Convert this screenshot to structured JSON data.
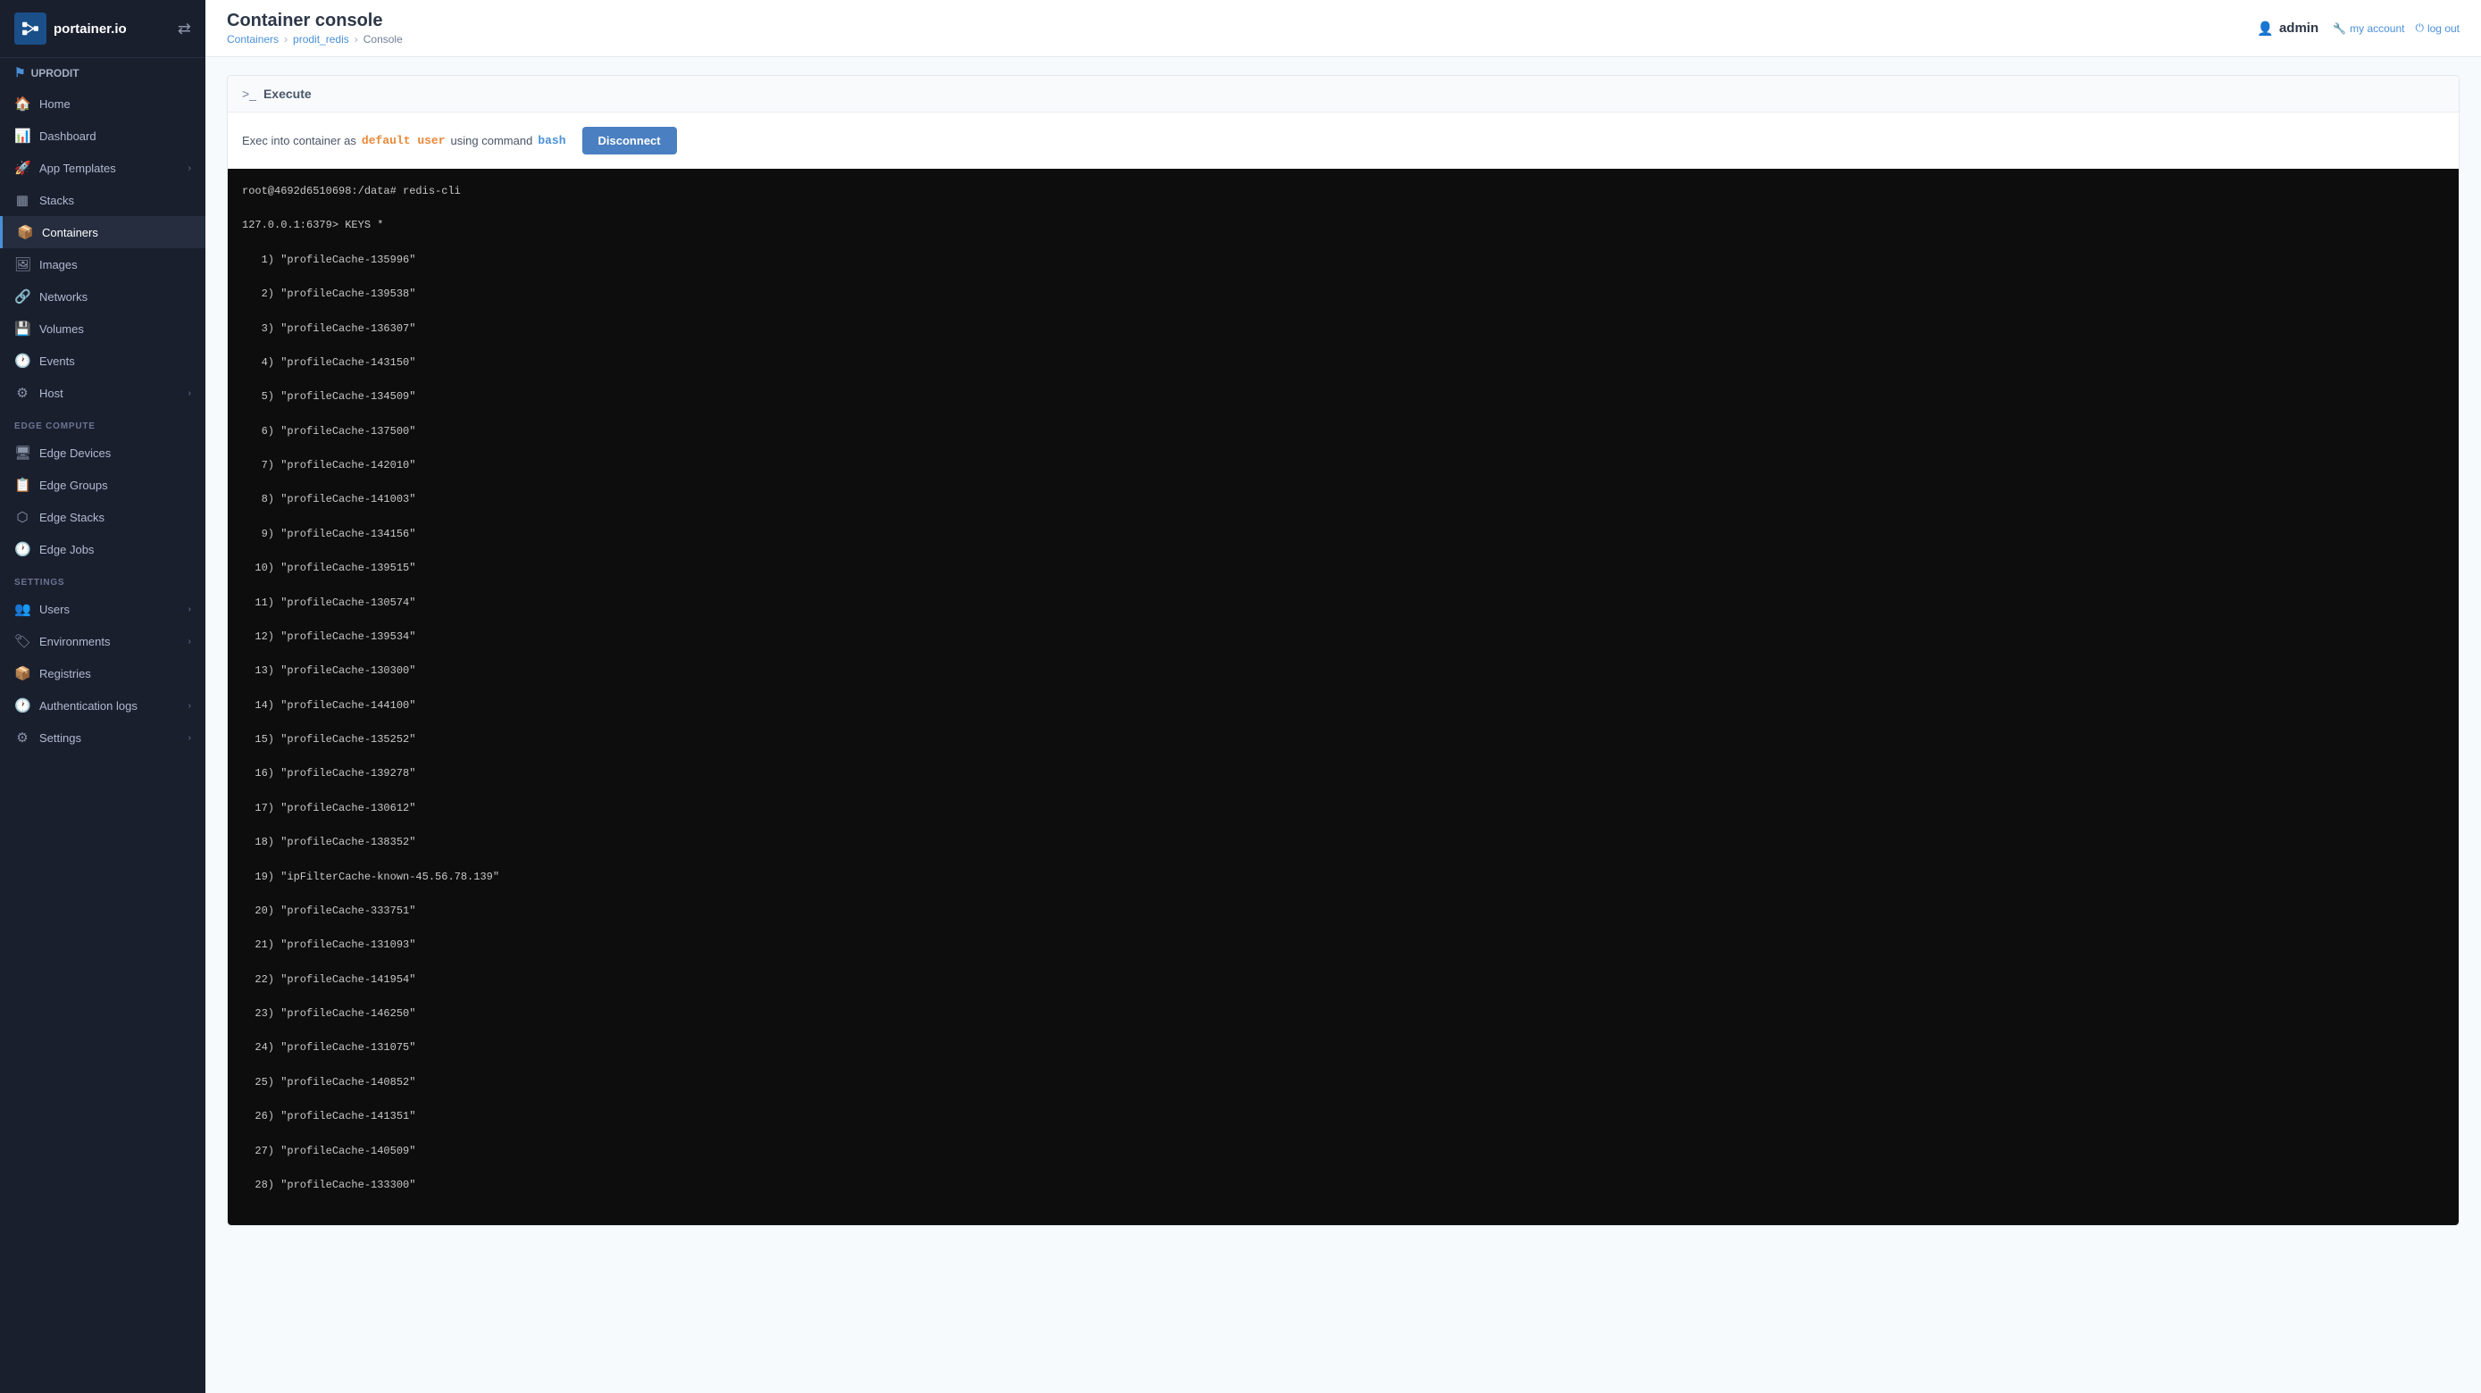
{
  "sidebar": {
    "logo_text": "portainer.io",
    "env_name": "UPRODIT",
    "items": [
      {
        "id": "home",
        "label": "Home",
        "icon": "🏠",
        "has_arrow": false,
        "active": false
      },
      {
        "id": "dashboard",
        "label": "Dashboard",
        "icon": "📊",
        "has_arrow": false,
        "active": false
      },
      {
        "id": "app-templates",
        "label": "App Templates",
        "icon": "🚀",
        "has_arrow": true,
        "active": false
      },
      {
        "id": "stacks",
        "label": "Stacks",
        "icon": "▦",
        "has_arrow": false,
        "active": false
      },
      {
        "id": "containers",
        "label": "Containers",
        "icon": "📦",
        "has_arrow": false,
        "active": true
      },
      {
        "id": "images",
        "label": "Images",
        "icon": "🖼",
        "has_arrow": false,
        "active": false
      },
      {
        "id": "networks",
        "label": "Networks",
        "icon": "🔗",
        "has_arrow": false,
        "active": false
      },
      {
        "id": "volumes",
        "label": "Volumes",
        "icon": "💾",
        "has_arrow": false,
        "active": false
      },
      {
        "id": "events",
        "label": "Events",
        "icon": "🕐",
        "has_arrow": false,
        "active": false
      },
      {
        "id": "host",
        "label": "Host",
        "icon": "⚙",
        "has_arrow": true,
        "active": false
      }
    ],
    "edge_compute_section": "EDGE COMPUTE",
    "edge_items": [
      {
        "id": "edge-devices",
        "label": "Edge Devices",
        "icon": "🖥",
        "has_arrow": false,
        "active": false
      },
      {
        "id": "edge-groups",
        "label": "Edge Groups",
        "icon": "📋",
        "has_arrow": false,
        "active": false
      },
      {
        "id": "edge-stacks",
        "label": "Edge Stacks",
        "icon": "⬡",
        "has_arrow": false,
        "active": false
      },
      {
        "id": "edge-jobs",
        "label": "Edge Jobs",
        "icon": "🕐",
        "has_arrow": false,
        "active": false
      }
    ],
    "settings_section": "SETTINGS",
    "settings_items": [
      {
        "id": "users",
        "label": "Users",
        "icon": "👥",
        "has_arrow": true,
        "active": false
      },
      {
        "id": "environments",
        "label": "Environments",
        "icon": "🏷",
        "has_arrow": true,
        "active": false
      },
      {
        "id": "registries",
        "label": "Registries",
        "icon": "📦",
        "has_arrow": false,
        "active": false
      },
      {
        "id": "auth-logs",
        "label": "Authentication logs",
        "icon": "🕐",
        "has_arrow": true,
        "active": false
      },
      {
        "id": "settings",
        "label": "Settings",
        "icon": "⚙",
        "has_arrow": true,
        "active": false
      }
    ]
  },
  "header": {
    "title": "Container console",
    "breadcrumb": [
      {
        "label": "Containers",
        "link": true
      },
      {
        "label": "prodit_redis",
        "link": true
      },
      {
        "label": "Console",
        "link": false
      }
    ],
    "user": {
      "name": "admin",
      "my_account": "my account",
      "log_out": "log out"
    }
  },
  "panel": {
    "execute_label": "Execute",
    "exec_info_prefix": "Exec into container as",
    "exec_user": "default user",
    "exec_using": "using command",
    "exec_command": "bash",
    "disconnect_label": "Disconnect"
  },
  "terminal": {
    "lines": [
      "root@4692d6510698:/data# redis-cli",
      "127.0.0.1:6379> KEYS *",
      "   1) \"profileCache-135996\"",
      "   2) \"profileCache-139538\"",
      "   3) \"profileCache-136307\"",
      "   4) \"profileCache-143150\"",
      "   5) \"profileCache-134509\"",
      "   6) \"profileCache-137500\"",
      "   7) \"profileCache-142010\"",
      "   8) \"profileCache-141003\"",
      "   9) \"profileCache-134156\"",
      "  10) \"profileCache-139515\"",
      "  11) \"profileCache-130574\"",
      "  12) \"profileCache-139534\"",
      "  13) \"profileCache-130300\"",
      "  14) \"profileCache-144100\"",
      "  15) \"profileCache-135252\"",
      "  16) \"profileCache-139278\"",
      "  17) \"profileCache-130612\"",
      "  18) \"profileCache-138352\"",
      "  19) \"ipFilterCache-known-45.56.78.139\"",
      "  20) \"profileCache-333751\"",
      "  21) \"profileCache-131093\"",
      "  22) \"profileCache-141954\"",
      "  23) \"profileCache-146250\"",
      "  24) \"profileCache-131075\"",
      "  25) \"profileCache-140852\"",
      "  26) \"profileCache-141351\"",
      "  27) \"profileCache-140509\"",
      "  28) \"profileCache-133300\""
    ]
  }
}
